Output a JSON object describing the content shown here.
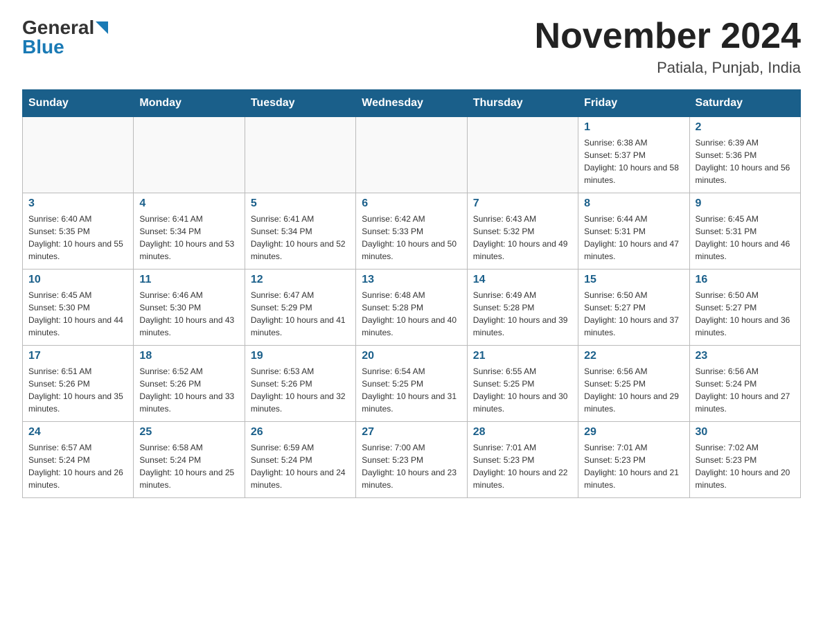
{
  "header": {
    "logo_general": "General",
    "logo_blue": "Blue",
    "month_title": "November 2024",
    "location": "Patiala, Punjab, India"
  },
  "days_of_week": [
    "Sunday",
    "Monday",
    "Tuesday",
    "Wednesday",
    "Thursday",
    "Friday",
    "Saturday"
  ],
  "weeks": [
    [
      {
        "day": "",
        "info": ""
      },
      {
        "day": "",
        "info": ""
      },
      {
        "day": "",
        "info": ""
      },
      {
        "day": "",
        "info": ""
      },
      {
        "day": "",
        "info": ""
      },
      {
        "day": "1",
        "info": "Sunrise: 6:38 AM\nSunset: 5:37 PM\nDaylight: 10 hours and 58 minutes."
      },
      {
        "day": "2",
        "info": "Sunrise: 6:39 AM\nSunset: 5:36 PM\nDaylight: 10 hours and 56 minutes."
      }
    ],
    [
      {
        "day": "3",
        "info": "Sunrise: 6:40 AM\nSunset: 5:35 PM\nDaylight: 10 hours and 55 minutes."
      },
      {
        "day": "4",
        "info": "Sunrise: 6:41 AM\nSunset: 5:34 PM\nDaylight: 10 hours and 53 minutes."
      },
      {
        "day": "5",
        "info": "Sunrise: 6:41 AM\nSunset: 5:34 PM\nDaylight: 10 hours and 52 minutes."
      },
      {
        "day": "6",
        "info": "Sunrise: 6:42 AM\nSunset: 5:33 PM\nDaylight: 10 hours and 50 minutes."
      },
      {
        "day": "7",
        "info": "Sunrise: 6:43 AM\nSunset: 5:32 PM\nDaylight: 10 hours and 49 minutes."
      },
      {
        "day": "8",
        "info": "Sunrise: 6:44 AM\nSunset: 5:31 PM\nDaylight: 10 hours and 47 minutes."
      },
      {
        "day": "9",
        "info": "Sunrise: 6:45 AM\nSunset: 5:31 PM\nDaylight: 10 hours and 46 minutes."
      }
    ],
    [
      {
        "day": "10",
        "info": "Sunrise: 6:45 AM\nSunset: 5:30 PM\nDaylight: 10 hours and 44 minutes."
      },
      {
        "day": "11",
        "info": "Sunrise: 6:46 AM\nSunset: 5:30 PM\nDaylight: 10 hours and 43 minutes."
      },
      {
        "day": "12",
        "info": "Sunrise: 6:47 AM\nSunset: 5:29 PM\nDaylight: 10 hours and 41 minutes."
      },
      {
        "day": "13",
        "info": "Sunrise: 6:48 AM\nSunset: 5:28 PM\nDaylight: 10 hours and 40 minutes."
      },
      {
        "day": "14",
        "info": "Sunrise: 6:49 AM\nSunset: 5:28 PM\nDaylight: 10 hours and 39 minutes."
      },
      {
        "day": "15",
        "info": "Sunrise: 6:50 AM\nSunset: 5:27 PM\nDaylight: 10 hours and 37 minutes."
      },
      {
        "day": "16",
        "info": "Sunrise: 6:50 AM\nSunset: 5:27 PM\nDaylight: 10 hours and 36 minutes."
      }
    ],
    [
      {
        "day": "17",
        "info": "Sunrise: 6:51 AM\nSunset: 5:26 PM\nDaylight: 10 hours and 35 minutes."
      },
      {
        "day": "18",
        "info": "Sunrise: 6:52 AM\nSunset: 5:26 PM\nDaylight: 10 hours and 33 minutes."
      },
      {
        "day": "19",
        "info": "Sunrise: 6:53 AM\nSunset: 5:26 PM\nDaylight: 10 hours and 32 minutes."
      },
      {
        "day": "20",
        "info": "Sunrise: 6:54 AM\nSunset: 5:25 PM\nDaylight: 10 hours and 31 minutes."
      },
      {
        "day": "21",
        "info": "Sunrise: 6:55 AM\nSunset: 5:25 PM\nDaylight: 10 hours and 30 minutes."
      },
      {
        "day": "22",
        "info": "Sunrise: 6:56 AM\nSunset: 5:25 PM\nDaylight: 10 hours and 29 minutes."
      },
      {
        "day": "23",
        "info": "Sunrise: 6:56 AM\nSunset: 5:24 PM\nDaylight: 10 hours and 27 minutes."
      }
    ],
    [
      {
        "day": "24",
        "info": "Sunrise: 6:57 AM\nSunset: 5:24 PM\nDaylight: 10 hours and 26 minutes."
      },
      {
        "day": "25",
        "info": "Sunrise: 6:58 AM\nSunset: 5:24 PM\nDaylight: 10 hours and 25 minutes."
      },
      {
        "day": "26",
        "info": "Sunrise: 6:59 AM\nSunset: 5:24 PM\nDaylight: 10 hours and 24 minutes."
      },
      {
        "day": "27",
        "info": "Sunrise: 7:00 AM\nSunset: 5:23 PM\nDaylight: 10 hours and 23 minutes."
      },
      {
        "day": "28",
        "info": "Sunrise: 7:01 AM\nSunset: 5:23 PM\nDaylight: 10 hours and 22 minutes."
      },
      {
        "day": "29",
        "info": "Sunrise: 7:01 AM\nSunset: 5:23 PM\nDaylight: 10 hours and 21 minutes."
      },
      {
        "day": "30",
        "info": "Sunrise: 7:02 AM\nSunset: 5:23 PM\nDaylight: 10 hours and 20 minutes."
      }
    ]
  ]
}
